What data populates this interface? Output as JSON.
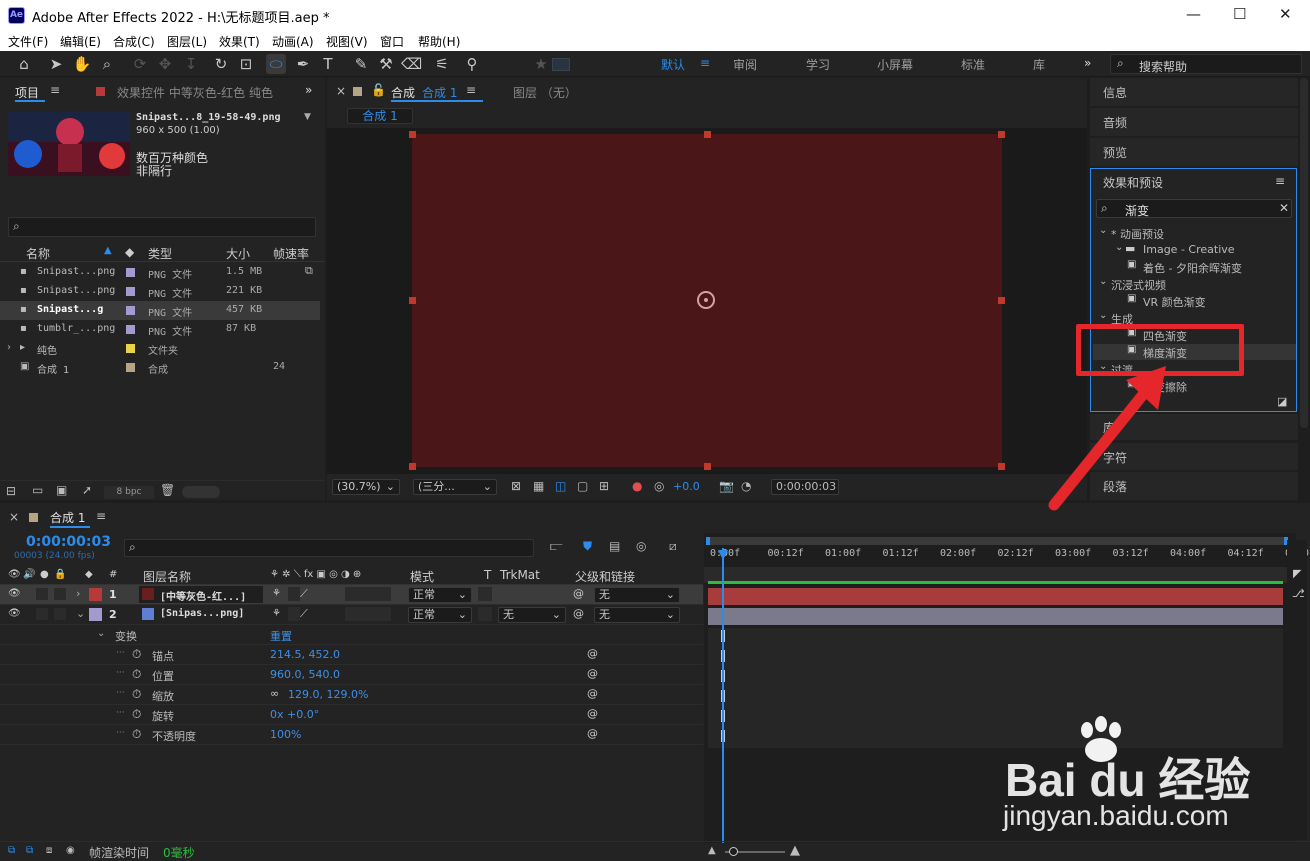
{
  "window": {
    "title": "Adobe After Effects 2022 - H:\\无标题项目.aep *",
    "logo": "Ae",
    "min": "—",
    "max": "☐",
    "close": "✕"
  },
  "menu": [
    "文件(F)",
    "编辑(E)",
    "合成(C)",
    "图层(L)",
    "效果(T)",
    "动画(A)",
    "视图(V)",
    "窗口",
    "帮助(H)"
  ],
  "workspaces": {
    "items": [
      "默认",
      "审阅",
      "学习",
      "小屏幕",
      "标准",
      "库"
    ],
    "active": "默认",
    "more": "»",
    "search_placeholder": "搜索帮助"
  },
  "project": {
    "tab": "项目",
    "effects_tab": "效果控件 中等灰色-红色 纯色",
    "expand": "»",
    "preview_name": "Snipast...8_19-58-49.png",
    "preview_size": "960 x 500 (1.00)",
    "preview_colors": "数百万种颜色",
    "preview_interlace": "非隔行",
    "columns": [
      "名称",
      "类型",
      "大小",
      "帧速率"
    ],
    "rows": [
      {
        "name": "Snipast...png",
        "type": "PNG 文件",
        "size": "1.5 MB",
        "fps": "",
        "color": "#a39ad0",
        "selected": false
      },
      {
        "name": "Snipast...png",
        "type": "PNG 文件",
        "size": "221 KB",
        "fps": "",
        "color": "#a39ad0",
        "selected": false
      },
      {
        "name": "Snipast...g",
        "type": "PNG 文件",
        "size": "457 KB",
        "fps": "",
        "color": "#a39ad0",
        "selected": true
      },
      {
        "name": "tumblr_...png",
        "type": "PNG 文件",
        "size": "87 KB",
        "fps": "",
        "color": "#a39ad0",
        "selected": false
      },
      {
        "name": "纯色",
        "type": "文件夹",
        "size": "",
        "fps": "",
        "color": "#e8d34a",
        "selected": false
      },
      {
        "name": "合成 1",
        "type": "合成",
        "size": "",
        "fps": "24",
        "color": "#b6a584",
        "selected": false
      }
    ],
    "bpc": "8 bpc"
  },
  "comp_viewer": {
    "tab": "合成",
    "tab_name": "合成 1",
    "layer_tab": "图层 （无）",
    "breadcrumb": "合成 1",
    "solid_color": "#4a1618",
    "zoom": "(30.7%)",
    "resolution": "(三分...",
    "exposure": "+0.0",
    "timecode": "0:00:00:03"
  },
  "right_panels": {
    "info": "信息",
    "audio": "音频",
    "preview": "预览",
    "effects": "效果和预设",
    "search": "渐变",
    "bottom": [
      "段落",
      "字符",
      "库"
    ]
  },
  "effects_tree": [
    {
      "label": "* 动画预设",
      "type": "group"
    },
    {
      "label": "Image - Creative",
      "type": "folder"
    },
    {
      "label": "着色 - 夕阳余晖渐变",
      "type": "item"
    },
    {
      "label": "沉浸式视频",
      "type": "group"
    },
    {
      "label": "VR 颜色渐变",
      "type": "item"
    },
    {
      "label": "生成",
      "type": "group"
    },
    {
      "label": "四色渐变",
      "type": "item"
    },
    {
      "label": "梯度渐变",
      "type": "item",
      "highlight": true
    },
    {
      "label": "过渡",
      "type": "group"
    },
    {
      "label": "渐变擦除",
      "type": "item"
    }
  ],
  "timeline": {
    "tab": "合成 1",
    "timecode": "0:00:00:03",
    "frames": "00003 (24.00 fps)",
    "col_labels": {
      "name": "图层名称",
      "mode": "模式",
      "t": "T",
      "trkmat": "TrkMat",
      "parent": "父级和链接"
    },
    "ruler": [
      "0:00f",
      "00:12f",
      "01:00f",
      "01:12f",
      "02:00f",
      "02:12f",
      "03:00f",
      "03:12f",
      "04:00f",
      "04:12f",
      "05:0"
    ],
    "layers": [
      {
        "num": "1",
        "name": "[中等灰色-红...]",
        "color": "#b73a3a",
        "mode": "正常",
        "trkmat": "",
        "parent": "无",
        "bar_color": "#a63c3c"
      },
      {
        "num": "2",
        "name": "[Snipas...png]",
        "color": "#a39ad0",
        "mode": "正常",
        "trkmat": "无",
        "parent": "无",
        "bar_color": "#7b7a8c"
      }
    ],
    "transform": {
      "label": "变换",
      "reset": "重置",
      "props": [
        {
          "name": "锚点",
          "value": "214.5, 452.0"
        },
        {
          "name": "位置",
          "value": "960.0, 540.0"
        },
        {
          "name": "缩放",
          "value": "129.0, 129.0%"
        },
        {
          "name": "旋转",
          "value": "0x +0.0°"
        },
        {
          "name": "不透明度",
          "value": "100%"
        }
      ]
    },
    "footer_label": "帧渲染时间",
    "footer_value": "0毫秒"
  },
  "watermark": {
    "brand": "Bai du 经验",
    "url": "jingyan.baidu.com"
  },
  "accent": "#2d8ceb",
  "annotation_color": "#e5262a"
}
